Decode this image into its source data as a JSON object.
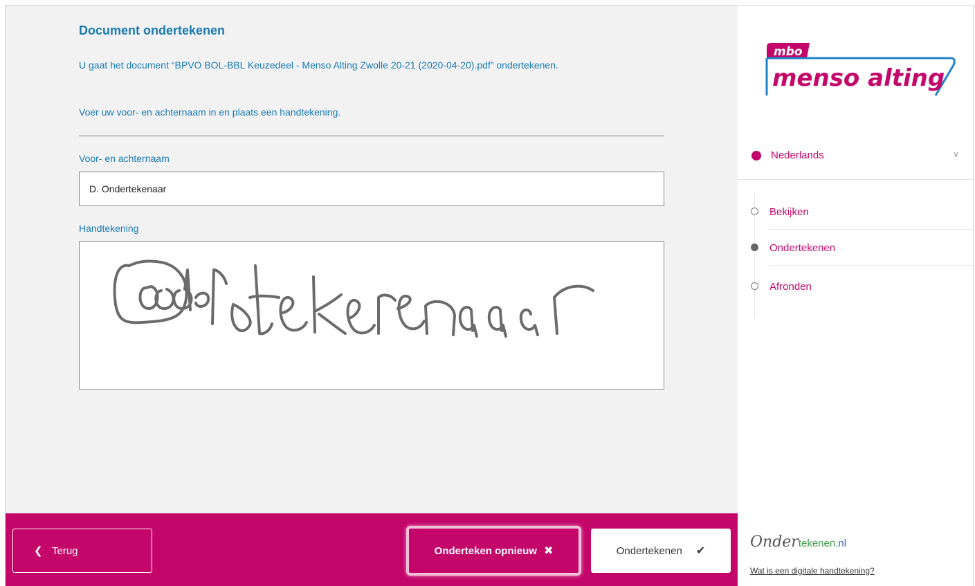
{
  "main": {
    "title": "Document ondertekenen",
    "intro": "U gaat het document “BPVO BOL-BBL Keuzedeel - Menso Alting Zwolle 20-21 (2020-04-20).pdf” ondertekenen.",
    "instruction": "Voer uw voor- en achternaam in en plaats een handtekening.",
    "name_label": "Voor- en achternaam",
    "name_value": "D. Ondertekenaar",
    "signature_label": "Handtekening"
  },
  "footer": {
    "back_label": "Terug",
    "redo_label": "Onderteken opnieuw",
    "sign_label": "Ondertekenen"
  },
  "sidebar": {
    "logo": {
      "top": "mbo",
      "bottom": "menso alting"
    },
    "language": "Nederlands",
    "steps": [
      {
        "label": "Bekijken",
        "state": "pending"
      },
      {
        "label": "Ondertekenen",
        "state": "current"
      },
      {
        "label": "Afronden",
        "state": "pending"
      }
    ],
    "brand": {
      "part1": "Onder",
      "part2": "tekenen",
      "part3": ".nl"
    },
    "help_link": "Wat is een digitale handtekening?"
  },
  "colors": {
    "primary": "#c4066b",
    "heading": "#1a7ab5",
    "logo_blue": "#1f82c9"
  },
  "icons": [
    "chevron-left-icon",
    "close-icon",
    "check-icon",
    "globe-icon",
    "chevron-down-icon"
  ]
}
